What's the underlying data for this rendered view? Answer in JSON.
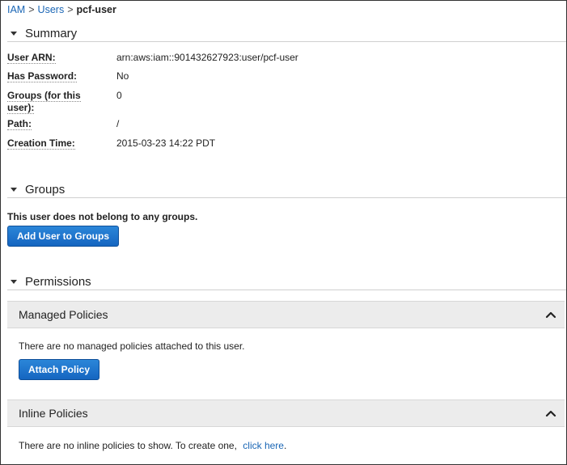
{
  "breadcrumb": {
    "iam": "IAM",
    "sep1": ">",
    "users": "Users",
    "sep2": ">",
    "current": "pcf-user"
  },
  "summary": {
    "title": "Summary",
    "rows": [
      {
        "key": "User ARN:",
        "value": "arn:aws:iam::901432627923:user/pcf-user"
      },
      {
        "key": "Has Password:",
        "value": "No"
      },
      {
        "key": "Groups (for this user):",
        "value": "0"
      },
      {
        "key": "Path:",
        "value": "/"
      },
      {
        "key": "Creation Time:",
        "value": "2015-03-23 14:22 PDT"
      }
    ]
  },
  "groups": {
    "title": "Groups",
    "message": "This user does not belong to any groups.",
    "add_button": "Add User to Groups"
  },
  "permissions": {
    "title": "Permissions",
    "managed": {
      "title": "Managed Policies",
      "message": "There are no managed policies attached to this user.",
      "attach_button": "Attach Policy"
    },
    "inline": {
      "title": "Inline Policies",
      "message": "There are no inline policies to show. To create one,",
      "link": "click here",
      "period": "."
    }
  },
  "colors": {
    "link": "#1a66b5",
    "button": "#1565c0",
    "panel_header": "#ececec"
  },
  "icons": {
    "section_toggle": "caret-down-icon",
    "panel_collapse": "chevron-up-icon"
  }
}
